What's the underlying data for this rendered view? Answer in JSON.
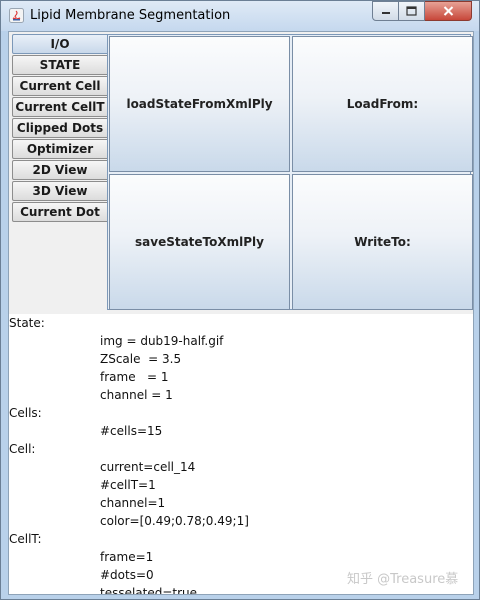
{
  "window": {
    "title": "Lipid Membrane Segmentation",
    "controls": {
      "minimize_icon": "minimize-icon",
      "maximize_icon": "maximize-icon",
      "close_icon": "close-icon"
    }
  },
  "tabs": [
    {
      "label": "I/O",
      "active": true
    },
    {
      "label": "STATE"
    },
    {
      "label": "Current Cell"
    },
    {
      "label": "Current CellT"
    },
    {
      "label": "Clipped Dots"
    },
    {
      "label": "Optimizer"
    },
    {
      "label": "2D View"
    },
    {
      "label": "3D View"
    },
    {
      "label": "Current Dot"
    }
  ],
  "buttons": {
    "load_state": "loadStateFromXmlPly",
    "load_from": "LoadFrom:",
    "save_state": "saveStateToXmlPly",
    "write_to": "WriteTo:"
  },
  "output_lines": [
    {
      "text": "State:",
      "indent": false
    },
    {
      "text": "img = dub19-half.gif",
      "indent": true
    },
    {
      "text": "ZScale  = 3.5",
      "indent": true
    },
    {
      "text": "frame   = 1",
      "indent": true
    },
    {
      "text": "channel = 1",
      "indent": true
    },
    {
      "text": "Cells:",
      "indent": false
    },
    {
      "text": "#cells=15",
      "indent": true
    },
    {
      "text": "Cell:",
      "indent": false
    },
    {
      "text": "current=cell_14",
      "indent": true
    },
    {
      "text": "#cellT=1",
      "indent": true
    },
    {
      "text": "channel=1",
      "indent": true
    },
    {
      "text": "color=[0.49;0.78;0.49;1]",
      "indent": true
    },
    {
      "text": "CellT:",
      "indent": false
    },
    {
      "text": "frame=1",
      "indent": true
    },
    {
      "text": "#dots=0",
      "indent": true
    },
    {
      "text": "tesselated=true",
      "indent": true
    }
  ],
  "watermark": "知乎 @Treasure慕",
  "colors": {
    "tab_active": "#c8d8ea",
    "button_gradient_bottom": "#c9d9ea",
    "close_button": "#c7473a"
  }
}
